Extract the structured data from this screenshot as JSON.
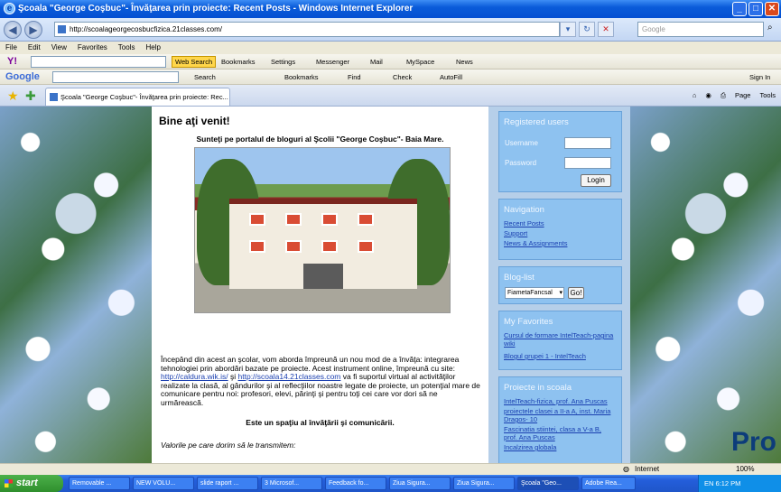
{
  "window": {
    "title": "Şcoala \"George Coşbuc\"- Învăţarea prin proiecte: Recent Posts - Windows Internet Explorer"
  },
  "address": {
    "url": "http://scoalageorgecosbucfizica.21classes.com/",
    "search_placeholder": "Google"
  },
  "menu": [
    "File",
    "Edit",
    "View",
    "Favorites",
    "Tools",
    "Help"
  ],
  "yahoo_bar": {
    "logo": "Y!",
    "web_search": "Web Search",
    "items": [
      "Bookmarks",
      "Settings",
      "Messenger",
      "Mail",
      "MySpace",
      "News"
    ]
  },
  "google_bar": {
    "logo": "Google",
    "items": [
      "Search",
      "Bookmarks",
      "Find",
      "Check",
      "AutoFill"
    ],
    "signin": "Sign In"
  },
  "tab": {
    "label": "Şcoala \"George Coşbuc\"- Învăţarea prin proiecte: Rec...",
    "tools": [
      "Page",
      "Tools"
    ]
  },
  "page": {
    "heading": "Bine aţi venit!",
    "intro": "Sunteţi pe portalul de bloguri al Şcolii \"George Coşbuc\"- Baia Mare.",
    "p1": "Începând din acest an şcolar, vom aborda împreună un nou mod de a învăţa: integrarea tehnologiei prin abordări bazate pe proiecte. Acest instrument online, împreună cu site: ",
    "link1": "http://caldura.wik.is/",
    "p2": " şi ",
    "link2": "http://scoala14.21classes.com",
    "p3": " va fi suportul virtual al activităţilor realizate la clasă, al gândurilor şi al reflecţiilor noastre legate de proiecte, un potenţial mare de comunicare pentru noi: profesori, elevi, părinţi şi pentru toţi cei care vor dori să ne urmărească.",
    "bold_line": "Este un spaţiu al învăţării şi comunicării.",
    "italic_line": "Valorile pe care dorim să le transmitem:"
  },
  "sidebar": {
    "registered": {
      "title": "Registered users",
      "username": "Username",
      "password": "Password",
      "login": "Login"
    },
    "navigation": {
      "title": "Navigation",
      "links": [
        "Recent Posts",
        "Support",
        "News & Assignments"
      ]
    },
    "bloglist": {
      "title": "Blog-list",
      "selected": "FiametaFancsal",
      "go": "Go!"
    },
    "favorites": {
      "title": "My Favorites",
      "links": [
        "Cursul de formare IntelTeach-pagina wiki",
        "Blogul grupei 1 - IntelTeach"
      ]
    },
    "projects": {
      "title": "Proiecte in scoala",
      "links": [
        "IntelTeach-fizica, prof. Ana Puscas",
        "proiectele clasei a II-a A, inst. Maria Dragos- 10",
        "Fascinatia stiintei, clasa a V-a B, prof. Ana Puscas",
        "Incalzirea globala"
      ]
    }
  },
  "overlay_text": "Pro",
  "status": {
    "zone": "Internet",
    "zoom": "100%"
  },
  "taskbar": {
    "start": "start",
    "tasks": [
      "Removable ...",
      "NEW VOLU...",
      "slide raport ...",
      "3 Microsof...",
      "Feedback fo...",
      "Ziua Sigura...",
      "Ziua Sigura...",
      "Şcoala \"Geo...",
      "Adobe Rea..."
    ],
    "tray": "EN  6:12 PM"
  }
}
